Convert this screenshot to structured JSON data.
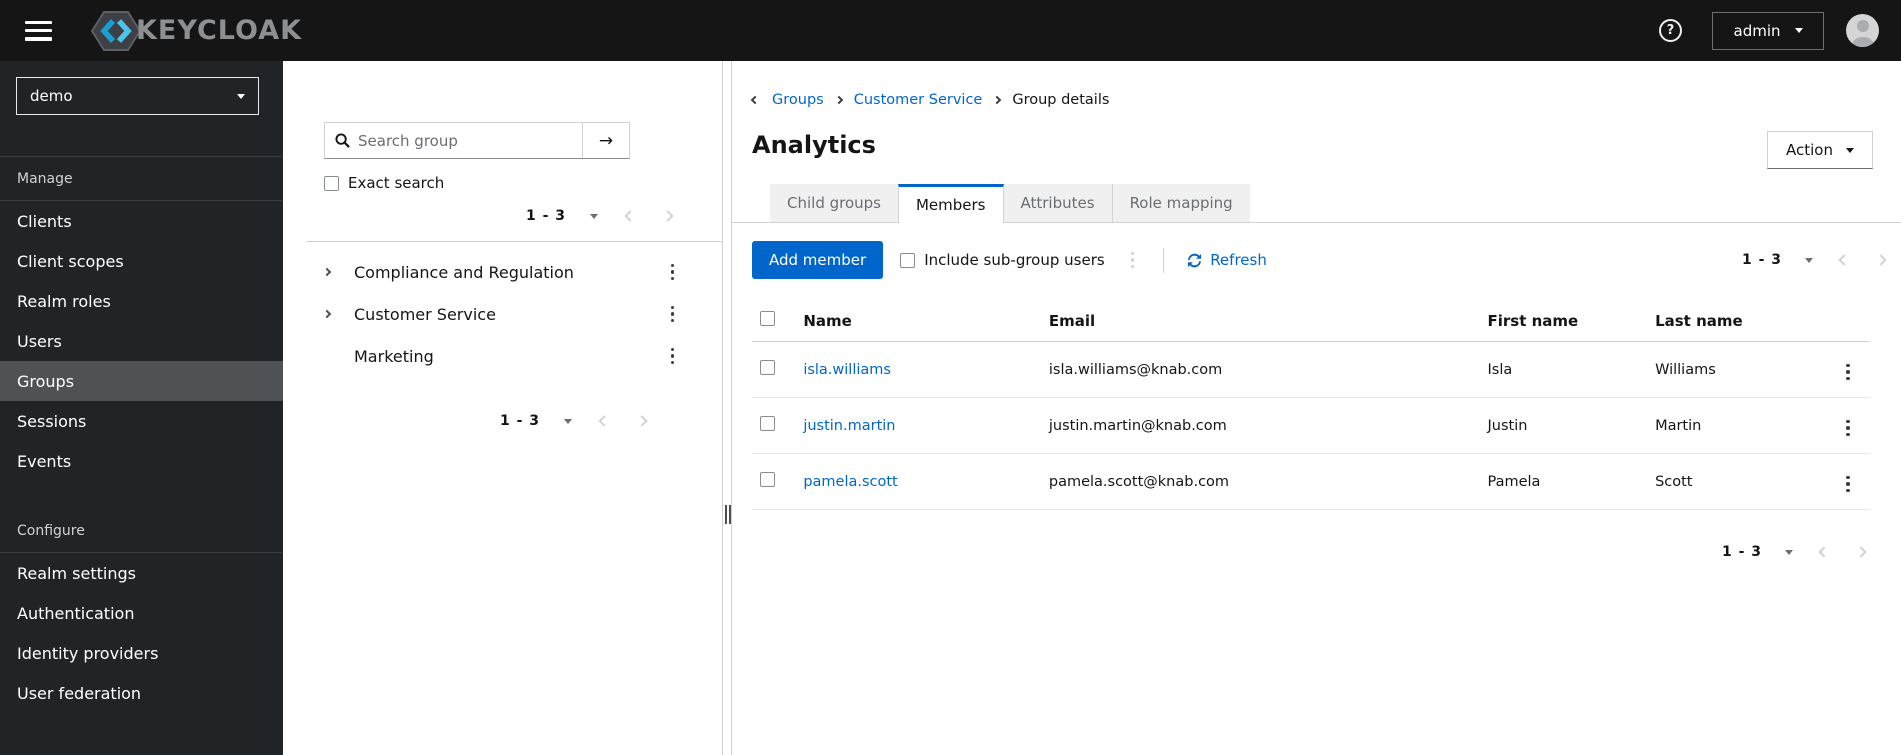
{
  "colors": {
    "accent": "#0066cc",
    "topbar_bg": "#151515",
    "sidebar_bg": "#212427",
    "selected_bg": "#4f5255"
  },
  "topbar": {
    "brand": "KEYCLOAK",
    "help": "?",
    "username": "admin"
  },
  "sidebar": {
    "realm": "demo",
    "manage_label": "Manage",
    "manage_items": [
      {
        "label": "Clients"
      },
      {
        "label": "Client scopes"
      },
      {
        "label": "Realm roles"
      },
      {
        "label": "Users"
      },
      {
        "label": "Groups"
      },
      {
        "label": "Sessions"
      },
      {
        "label": "Events"
      }
    ],
    "selected_item": "Groups",
    "configure_label": "Configure",
    "configure_items": [
      {
        "label": "Realm settings"
      },
      {
        "label": "Authentication"
      },
      {
        "label": "Identity providers"
      },
      {
        "label": "User federation"
      }
    ]
  },
  "groups_panel": {
    "search_placeholder": "Search group",
    "exact_search_label": "Exact search",
    "pagination_top": "1 - 3",
    "pagination_bottom": "1 - 3",
    "tree": [
      {
        "label": "Compliance and Regulation",
        "expandable": true
      },
      {
        "label": "Customer Service",
        "expandable": true
      },
      {
        "label": "Marketing",
        "expandable": false
      }
    ]
  },
  "main": {
    "breadcrumb": {
      "items": [
        {
          "label": "Groups"
        },
        {
          "label": "Customer Service"
        },
        {
          "label": "Group details"
        }
      ]
    },
    "title": "Analytics",
    "action_label": "Action",
    "tabs": [
      {
        "label": "Child groups",
        "active": false
      },
      {
        "label": "Members",
        "active": true
      },
      {
        "label": "Attributes",
        "active": false
      },
      {
        "label": "Role mapping",
        "active": false
      }
    ],
    "toolbar": {
      "add_member_label": "Add member",
      "include_subgroups_label": "Include sub-group users",
      "refresh_label": "Refresh",
      "pagination": "1 - 3"
    },
    "members_table": {
      "headers": {
        "name": "Name",
        "email": "Email",
        "first": "First name",
        "last": "Last name"
      },
      "rows": [
        {
          "name": "isla.williams",
          "email": "isla.williams@knab.com",
          "first": "Isla",
          "last": "Williams"
        },
        {
          "name": "justin.martin",
          "email": "justin.martin@knab.com",
          "first": "Justin",
          "last": "Martin"
        },
        {
          "name": "pamela.scott",
          "email": "pamela.scott@knab.com",
          "first": "Pamela",
          "last": "Scott"
        }
      ],
      "pagination": "1 - 3"
    }
  }
}
